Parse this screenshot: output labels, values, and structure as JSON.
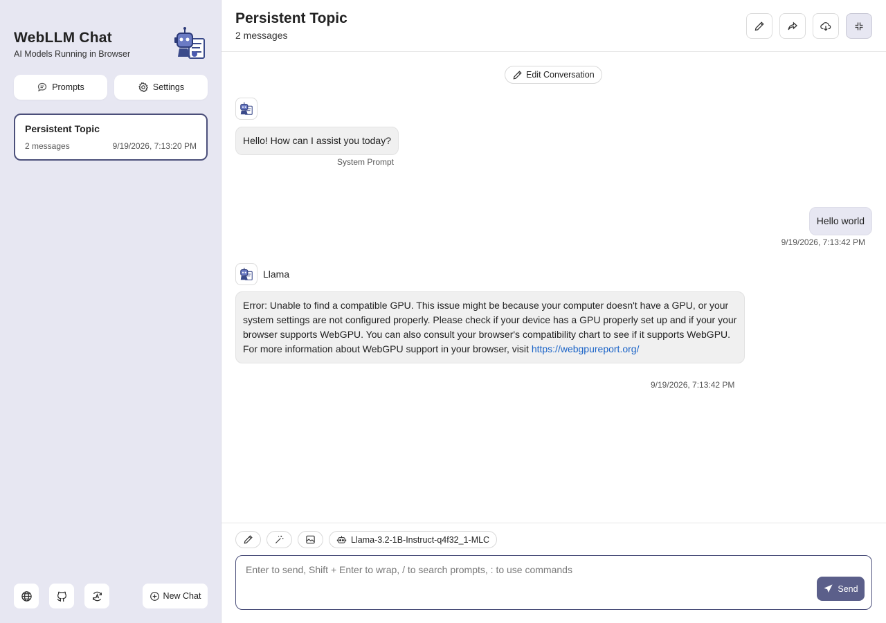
{
  "sidebar": {
    "title": "WebLLM Chat",
    "subtitle": "AI Models Running in Browser",
    "logo_icon": "robot-icon",
    "buttons": {
      "prompts": {
        "label": "Prompts",
        "icon": "chat-bubble-icon"
      },
      "settings": {
        "label": "Settings",
        "icon": "gear-icon"
      }
    },
    "chats": [
      {
        "title": "Persistent Topic",
        "count": "2 messages",
        "time": "9/19/2026, 7:13:20 PM",
        "selected": true
      }
    ],
    "footer": {
      "icons": [
        "globe-icon",
        "github-icon",
        "model-icon"
      ],
      "new_chat_label": "New Chat"
    }
  },
  "header": {
    "title": "Persistent Topic",
    "subtitle": "2 messages",
    "actions": [
      "edit-icon",
      "share-icon",
      "download-icon",
      "collapse-icon"
    ]
  },
  "chat": {
    "edit_label": "Edit Conversation",
    "messages": [
      {
        "role": "assistant",
        "text": "Hello! How can I assist you today?",
        "meta": "System Prompt"
      },
      {
        "role": "user",
        "text": "Hello world",
        "meta": "9/19/2026, 7:13:42 PM"
      },
      {
        "role": "assistant",
        "sender": "Llama",
        "text": "Error: Unable to find a compatible GPU. This issue might be because your computer doesn't have a GPU, or your system settings are not configured properly. Please check if your device has a GPU properly set up and if your your browser supports WebGPU. You can also consult your browser's compatibility chart to see if it supports WebGPU. For more information about WebGPU support in your browser, visit",
        "link": "https://webgpureport.org/",
        "meta": "9/19/2026, 7:13:42 PM"
      }
    ]
  },
  "composer": {
    "tools": [
      "pencil-icon",
      "magic-wand-icon",
      "image-icon"
    ],
    "model": "Llama-3.2-1B-Instruct-q4f32_1-MLC",
    "placeholder": "Enter to send, Shift + Enter to wrap, / to search prompts, : to use commands",
    "send_label": "Send"
  },
  "colors": {
    "sidebar_bg": "#e7e7f2",
    "accent": "#4b4f7a",
    "send_bg": "#5b5f8a",
    "link": "#1a63c7"
  }
}
